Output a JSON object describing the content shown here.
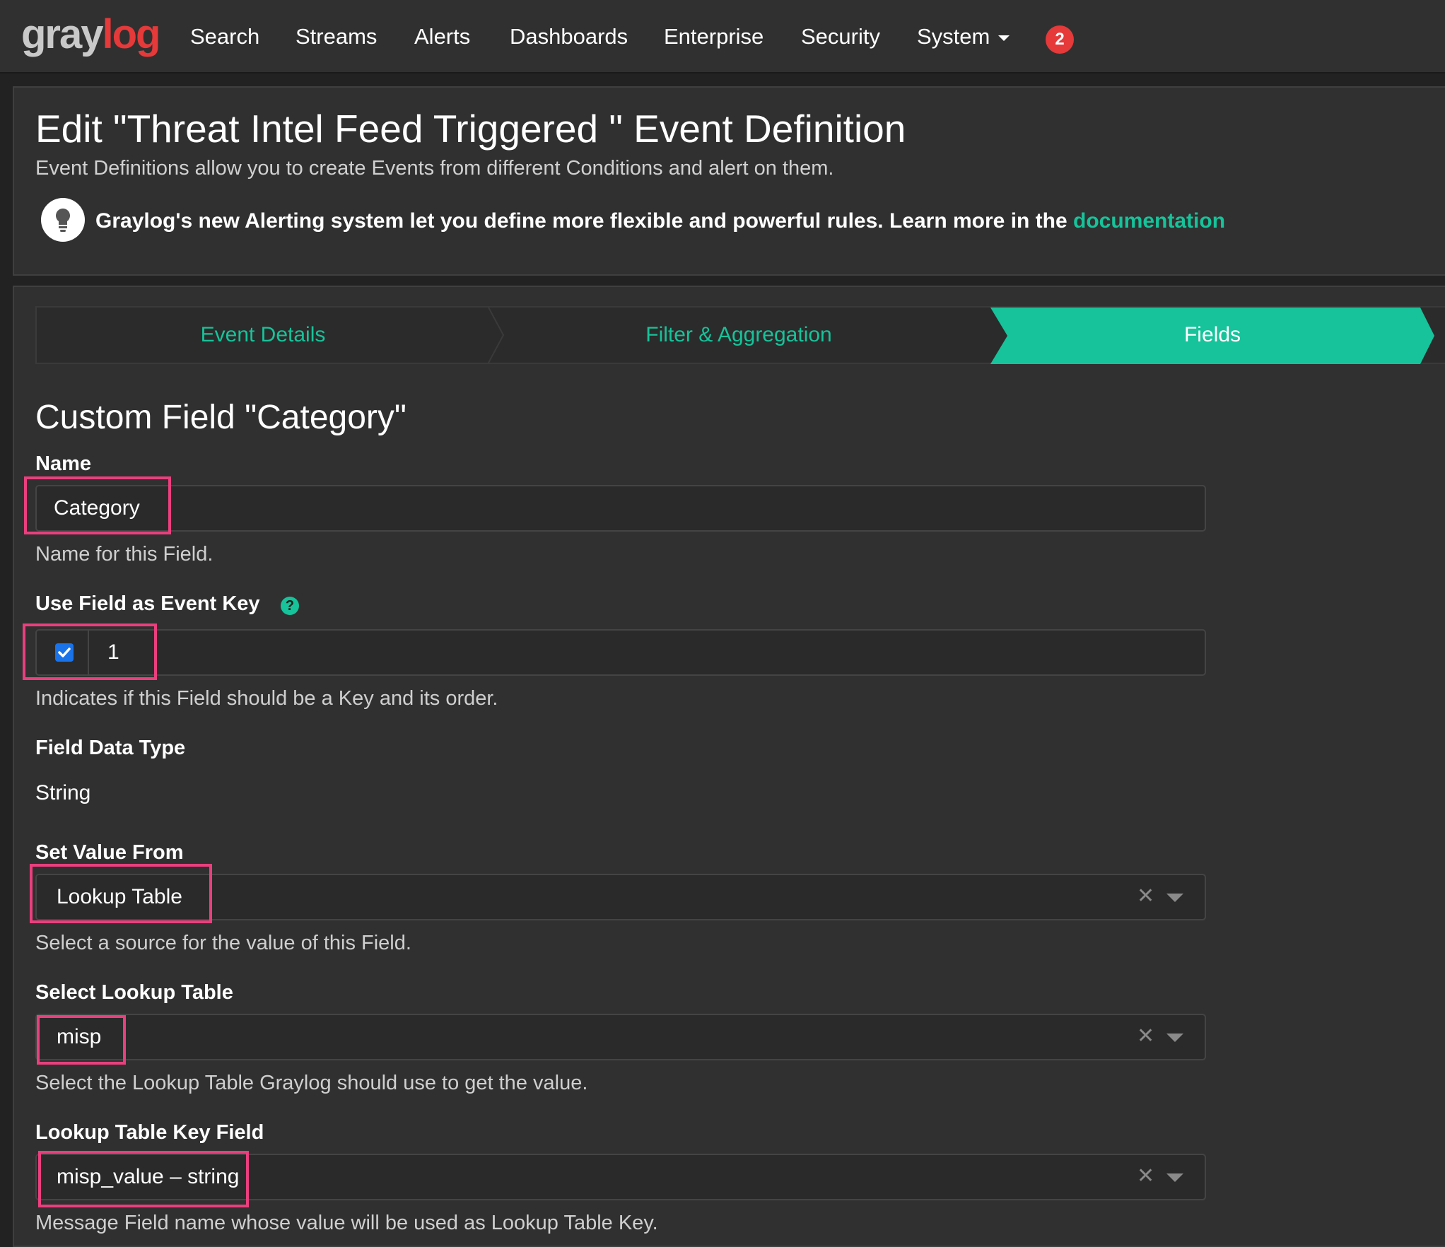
{
  "navbar": {
    "logo_gray": "gray",
    "logo_red": "log",
    "items": [
      {
        "label": "Search"
      },
      {
        "label": "Streams"
      },
      {
        "label": "Alerts"
      },
      {
        "label": "Dashboards"
      },
      {
        "label": "Enterprise"
      },
      {
        "label": "Security"
      },
      {
        "label": "System"
      }
    ],
    "notification_count": "2"
  },
  "header": {
    "title": "Edit \"Threat Intel Feed Triggered \" Event Definition",
    "description": "Event Definitions allow you to create Events from different Conditions and alert on them.",
    "tip_text": "Graylog's new Alerting system let you define more flexible and powerful rules. Learn more in the",
    "tip_link": "documentation"
  },
  "wizard": {
    "steps": [
      {
        "label": "Event Details",
        "active": false
      },
      {
        "label": "Filter & Aggregation",
        "active": false
      },
      {
        "label": "Fields",
        "active": true
      }
    ],
    "accent_color": "#16c39a"
  },
  "form": {
    "section_title": "Custom Field \"Category\"",
    "name": {
      "label": "Name",
      "value": "Category",
      "help": "Name for this Field."
    },
    "event_key": {
      "label": "Use Field as Event Key",
      "checked": true,
      "order": "1",
      "help": "Indicates if this Field should be a Key and its order."
    },
    "data_type": {
      "label": "Field Data Type",
      "value": "String"
    },
    "value_from": {
      "label": "Set Value From",
      "value": "Lookup Table",
      "help": "Select a source for the value of this Field."
    },
    "lookup_table": {
      "label": "Select Lookup Table",
      "value": "misp",
      "help": "Select the Lookup Table Graylog should use to get the value."
    },
    "key_field": {
      "label": "Lookup Table Key Field",
      "value": "misp_value – string",
      "help": "Message Field name whose value will be used as Lookup Table Key."
    }
  },
  "highlight_color": "#ea3f7d"
}
